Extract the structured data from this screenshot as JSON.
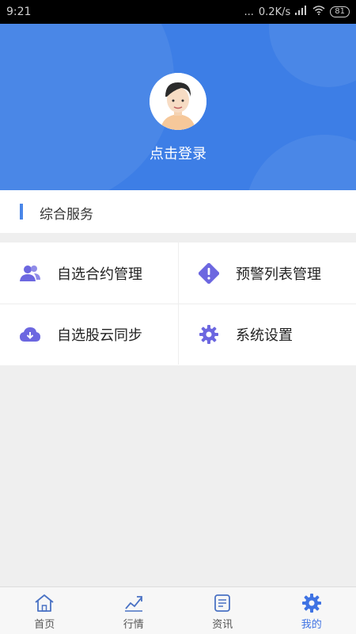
{
  "status_bar": {
    "time": "9:21",
    "network_speed": "0.2K/s",
    "battery": "81",
    "dots": "..."
  },
  "profile": {
    "login_text": "点击登录"
  },
  "section": {
    "title": "综合服务"
  },
  "menu": {
    "items": [
      {
        "label": "自选合约管理",
        "icon": "users-icon"
      },
      {
        "label": "预警列表管理",
        "icon": "alert-icon"
      },
      {
        "label": "自选股云同步",
        "icon": "cloud-download-icon"
      },
      {
        "label": "系统设置",
        "icon": "gear-icon"
      }
    ],
    "icon_color": "#6c67e0"
  },
  "tabs": [
    {
      "label": "首页",
      "icon": "home-icon"
    },
    {
      "label": "行情",
      "icon": "trend-icon"
    },
    {
      "label": "资讯",
      "icon": "news-icon"
    },
    {
      "label": "我的",
      "icon": "gear-icon",
      "active": true
    }
  ],
  "colors": {
    "hero": "#3d7ee6",
    "accent": "#3f73e3"
  }
}
